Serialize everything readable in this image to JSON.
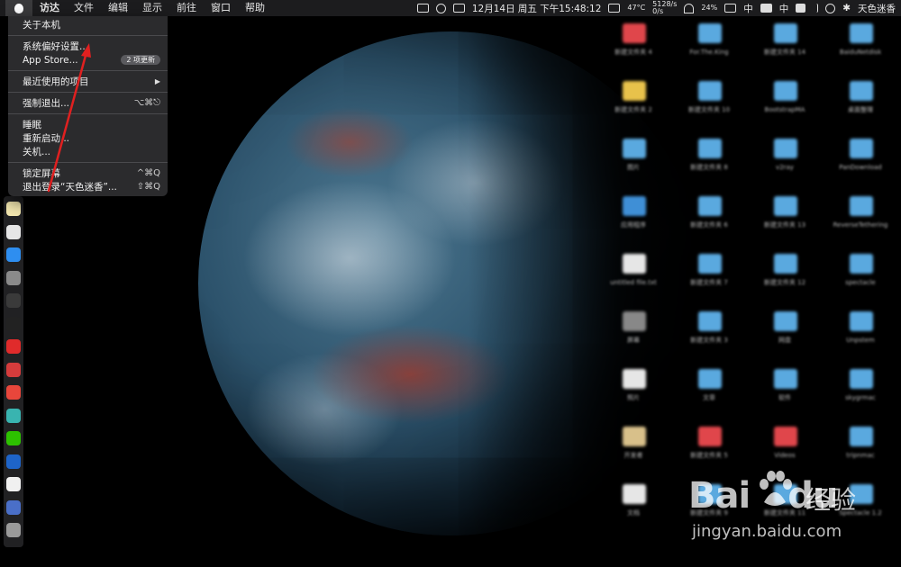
{
  "menubar": {
    "app_name": "访达",
    "items": [
      "文件",
      "编辑",
      "显示",
      "前往",
      "窗口",
      "帮助"
    ],
    "status": {
      "clock": "12月14日 周五 下午15:48:12",
      "temp": "47°C",
      "net_up": "5128/s",
      "net_down": "0/s",
      "battery": "24%",
      "ime": "中",
      "ime2": "中",
      "user": "天色迷香"
    }
  },
  "apple_menu": {
    "about": "关于本机",
    "system_prefs": "系统偏好设置...",
    "app_store": "App Store...",
    "app_store_badge": "2 项更新",
    "recent_items": "最近使用的项目",
    "force_quit": "强制退出...",
    "force_quit_shortcut": "⌥⌘⎋",
    "sleep": "睡眠",
    "restart": "重新启动...",
    "shutdown": "关机...",
    "lock_screen": "锁定屏幕",
    "lock_screen_shortcut": "^⌘Q",
    "logout": "退出登录“天色迷香”...",
    "logout_shortcut": "⇧⌘Q"
  },
  "desktop_icons": [
    {
      "label": "新建文件夹 4",
      "color": "#e0464b"
    },
    {
      "label": "For.The.King",
      "color": "#5aa9df"
    },
    {
      "label": "新建文件夹 14",
      "color": "#5aa9df"
    },
    {
      "label": "BaiduNetdisk",
      "color": "#5aa9df"
    },
    {
      "label": "新建文件夹 2",
      "color": "#e8c24b"
    },
    {
      "label": "新建文件夹 10",
      "color": "#5aa9df"
    },
    {
      "label": "BootstrapMA",
      "color": "#5aa9df"
    },
    {
      "label": "桌面整理",
      "color": "#5aa9df"
    },
    {
      "label": "图片",
      "color": "#5aa9df"
    },
    {
      "label": "新建文件夹 8",
      "color": "#5aa9df"
    },
    {
      "label": "v2ray",
      "color": "#5aa9df"
    },
    {
      "label": "PanDownload",
      "color": "#5aa9df"
    },
    {
      "label": "应用程序",
      "color": "#3f8fd6"
    },
    {
      "label": "新建文件夹 6",
      "color": "#5aa9df"
    },
    {
      "label": "新建文件夹 13",
      "color": "#5aa9df"
    },
    {
      "label": "ReverseTethering",
      "color": "#5aa9df"
    },
    {
      "label": "untitled file.txt",
      "color": "#e6e6e6"
    },
    {
      "label": "新建文件夹 7",
      "color": "#5aa9df"
    },
    {
      "label": "新建文件夹 12",
      "color": "#5aa9df"
    },
    {
      "label": "spectacle",
      "color": "#5aa9df"
    },
    {
      "label": "屏幕",
      "color": "#888888"
    },
    {
      "label": "新建文件夹 3",
      "color": "#5aa9df"
    },
    {
      "label": "网盘",
      "color": "#5aa9df"
    },
    {
      "label": "Unpstem",
      "color": "#5aa9df"
    },
    {
      "label": "照片",
      "color": "#e6e6e6"
    },
    {
      "label": "文章",
      "color": "#5aa9df"
    },
    {
      "label": "软件",
      "color": "#5aa9df"
    },
    {
      "label": "skygrmac",
      "color": "#5aa9df"
    },
    {
      "label": "开发者",
      "color": "#d8c08a"
    },
    {
      "label": "新建文件夹 5",
      "color": "#e0464b"
    },
    {
      "label": "Videos",
      "color": "#e0464b"
    },
    {
      "label": "tripnmac",
      "color": "#5aa9df"
    },
    {
      "label": "文档",
      "color": "#e6e6e6"
    },
    {
      "label": "新建文件夹 9",
      "color": "#5aa9df"
    },
    {
      "label": "新建文件夹 11",
      "color": "#5aa9df"
    },
    {
      "label": "Spectacle 1.2",
      "color": "#5aa9df"
    }
  ],
  "dock_icons": [
    {
      "name": "notes",
      "color": "#f4e8b0"
    },
    {
      "name": "photos",
      "color": "#e6e6e6"
    },
    {
      "name": "app-store",
      "color": "#2e8ef0"
    },
    {
      "name": "system-prefs",
      "color": "#8a8a8a"
    },
    {
      "name": "activity",
      "color": "#3a3a3a"
    },
    {
      "name": "terminal",
      "color": "#222222"
    },
    {
      "name": "yandex",
      "color": "#e02b2b"
    },
    {
      "name": "vivaldi",
      "color": "#d53c3c"
    },
    {
      "name": "weibo",
      "color": "#e8463b"
    },
    {
      "name": "qq",
      "color": "#39b4b0"
    },
    {
      "name": "wechat",
      "color": "#2dc100"
    },
    {
      "name": "quicktime",
      "color": "#1e64c8"
    },
    {
      "name": "textedit",
      "color": "#f0f0f0"
    },
    {
      "name": "preview",
      "color": "#4a6fc8"
    },
    {
      "name": "trash",
      "color": "#9a9a9a"
    }
  ],
  "watermark": {
    "logo_text": "Bai",
    "logo_text2": "du",
    "cn_text": "经验",
    "url": "jingyan.baidu.com"
  }
}
